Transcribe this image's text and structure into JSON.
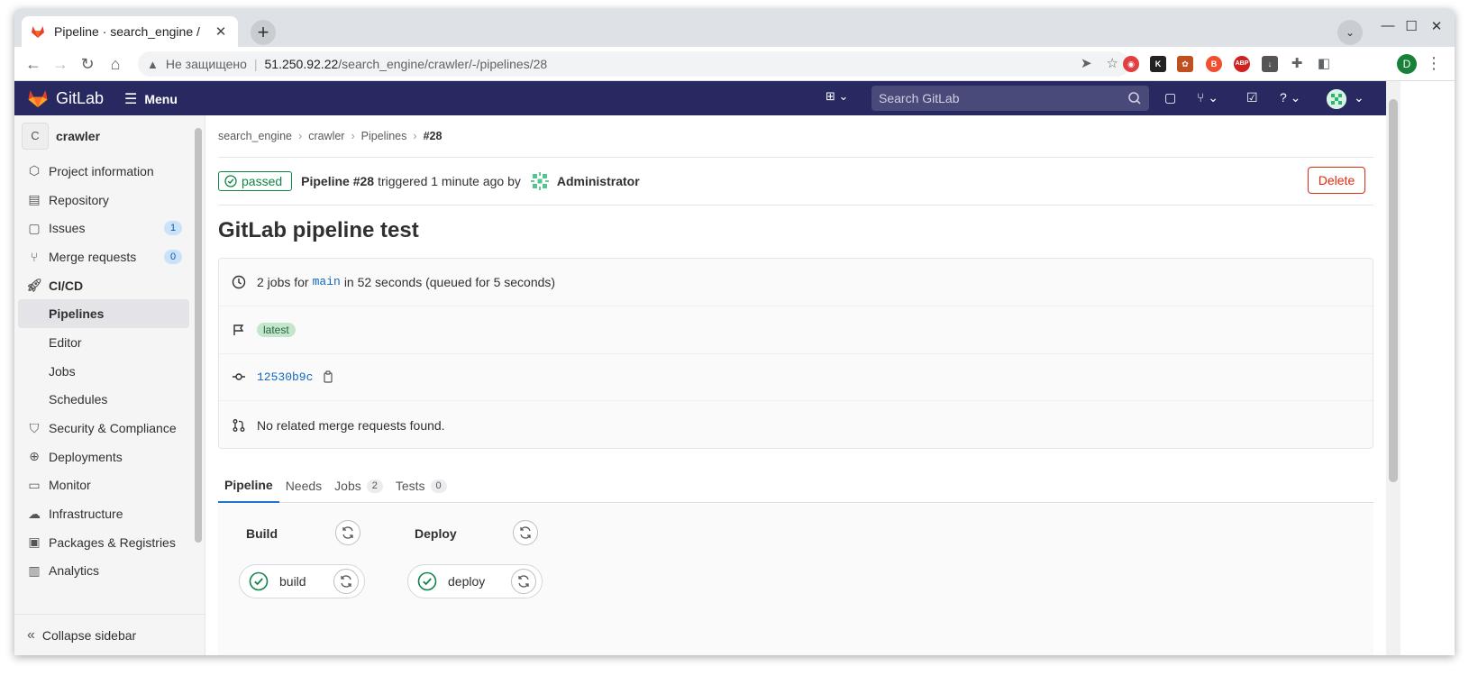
{
  "browser": {
    "tab_title": "Pipeline · search_engine /",
    "not_secure": "Не защищено",
    "url_host": "51.250.92.22",
    "url_path": "/search_engine/crawler/-/pipelines/28",
    "profile_initial": "D"
  },
  "header": {
    "logo": "GitLab",
    "menu": "Menu",
    "search_placeholder": "Search GitLab"
  },
  "sidebar": {
    "project_initial": "C",
    "project_name": "crawler",
    "items": [
      {
        "label": "Project information"
      },
      {
        "label": "Repository"
      },
      {
        "label": "Issues",
        "count": "1"
      },
      {
        "label": "Merge requests",
        "count": "0"
      },
      {
        "label": "CI/CD"
      },
      {
        "label": "Pipelines"
      },
      {
        "label": "Editor"
      },
      {
        "label": "Jobs"
      },
      {
        "label": "Schedules"
      },
      {
        "label": "Security & Compliance"
      },
      {
        "label": "Deployments"
      },
      {
        "label": "Monitor"
      },
      {
        "label": "Infrastructure"
      },
      {
        "label": "Packages & Registries"
      },
      {
        "label": "Analytics"
      }
    ],
    "collapse": "Collapse sidebar"
  },
  "breadcrumb": [
    "search_engine",
    "crawler",
    "Pipelines",
    "#28"
  ],
  "pipeline": {
    "status": "passed",
    "id_label": "Pipeline #28",
    "triggered": "triggered 1 minute ago by",
    "user": "Administrator",
    "delete": "Delete",
    "title": "GitLab pipeline test",
    "jobs_prefix": "2 jobs for",
    "branch": "main",
    "jobs_suffix": "in 52 seconds (queued for 5 seconds)",
    "tag": "latest",
    "commit": "12530b9c",
    "merge_requests": "No related merge requests found."
  },
  "tabs": [
    {
      "label": "Pipeline"
    },
    {
      "label": "Needs"
    },
    {
      "label": "Jobs",
      "count": "2"
    },
    {
      "label": "Tests",
      "count": "0"
    }
  ],
  "stages": [
    {
      "name": "Build",
      "job": "build"
    },
    {
      "name": "Deploy",
      "job": "deploy"
    }
  ],
  "colors": {
    "header_bg": "#292961",
    "success": "#108548",
    "danger": "#dd2b0e",
    "link": "#1068bf",
    "active_tab": "#1f75cb"
  }
}
